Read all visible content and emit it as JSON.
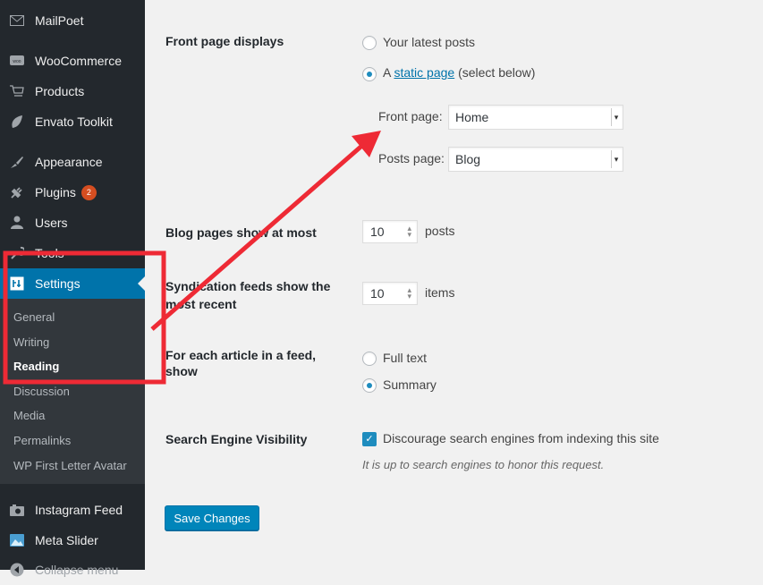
{
  "sidebar": {
    "items": [
      {
        "label": "MailPoet",
        "icon": "mail-icon"
      },
      {
        "label": "WooCommerce",
        "icon": "woo-icon"
      },
      {
        "label": "Products",
        "icon": "cart-icon"
      },
      {
        "label": "Envato Toolkit",
        "icon": "leaf-icon"
      },
      {
        "label": "Appearance",
        "icon": "brush-icon"
      },
      {
        "label": "Plugins",
        "icon": "plug-icon",
        "badge": "2"
      },
      {
        "label": "Users",
        "icon": "user-icon"
      },
      {
        "label": "Tools",
        "icon": "wrench-icon"
      },
      {
        "label": "Settings",
        "icon": "settings-icon"
      },
      {
        "label": "Instagram Feed",
        "icon": "camera-icon"
      },
      {
        "label": "Meta Slider",
        "icon": "image-icon"
      },
      {
        "label": "Collapse menu",
        "icon": "collapse-icon"
      }
    ],
    "submenu": [
      "General",
      "Writing",
      "Reading",
      "Discussion",
      "Media",
      "Permalinks",
      "WP First Letter Avatar"
    ]
  },
  "settings": {
    "front_page_displays": {
      "label": "Front page displays",
      "option_latest": "Your latest posts",
      "option_static_prefix": "A",
      "option_static_link": "static page",
      "option_static_suffix": "(select below)",
      "front_page_label": "Front page:",
      "front_page_value": "Home",
      "posts_page_label": "Posts page:",
      "posts_page_value": "Blog"
    },
    "blog_pages": {
      "label": "Blog pages show at most",
      "value": "10",
      "unit": "posts"
    },
    "syndication": {
      "label_line1": "Syndication feeds show the",
      "label_line2": "most recent",
      "value": "10",
      "unit": "items"
    },
    "feed_article": {
      "label_line1": "For each article in a feed,",
      "label_line2": "show",
      "option_full": "Full text",
      "option_summary": "Summary"
    },
    "search_visibility": {
      "label": "Search Engine Visibility",
      "checkbox_label": "Discourage search engines from indexing this site",
      "description": "It is up to search engines to honor this request."
    },
    "save_label": "Save Changes"
  },
  "annotation": {
    "color": "#ee2a35"
  }
}
